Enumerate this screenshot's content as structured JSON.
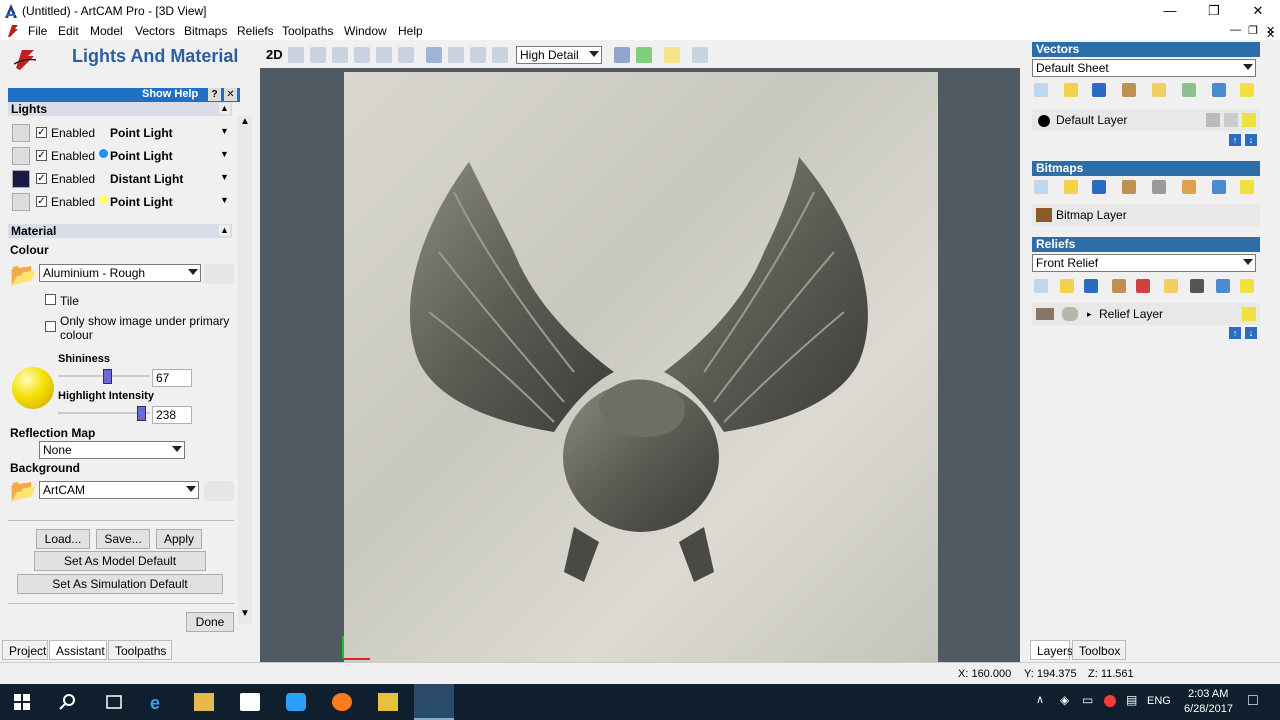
{
  "window": {
    "title": "(Untitled) - ArtCAM Pro - [3D View]"
  },
  "menu": [
    "File",
    "Edit",
    "Model",
    "Vectors",
    "Bitmaps",
    "Reliefs",
    "Toolpaths",
    "Window",
    "Help"
  ],
  "left": {
    "title": "Lights And Material",
    "show_help": "Show Help",
    "lights_header": "Lights",
    "lights": [
      {
        "enabled": "Enabled",
        "type": "Point Light",
        "dot": ""
      },
      {
        "enabled": "Enabled",
        "type": "Point Light",
        "dot": "#1e90ff"
      },
      {
        "enabled": "Enabled",
        "type": "Distant Light",
        "dot": ""
      },
      {
        "enabled": "Enabled",
        "type": "Point Light",
        "dot": "#ffff66"
      }
    ],
    "material_header": "Material",
    "colour_label": "Colour",
    "colour_value": "Aluminium - Rough",
    "tile": "Tile",
    "only_show": "Only show image under primary colour",
    "shininess_label": "Shininess",
    "shininess_value": "67",
    "highlight_label": "Highlight Intensity",
    "highlight_value": "238",
    "reflection_label": "Reflection Map",
    "reflection_value": "None",
    "background_label": "Background",
    "background_value": "ArtCAM",
    "load": "Load...",
    "save": "Save...",
    "apply": "Apply",
    "set_model": "Set As Model Default",
    "set_sim": "Set As Simulation Default",
    "done": "Done"
  },
  "view": {
    "mode": "2D",
    "detail": "High Detail"
  },
  "vectors": {
    "header": "Vectors",
    "sheet": "Default Sheet",
    "layer": "Default Layer"
  },
  "bitmaps": {
    "header": "Bitmaps",
    "layer": "Bitmap Layer"
  },
  "reliefs": {
    "header": "Reliefs",
    "sheet": "Front Relief",
    "layer": "Relief Layer"
  },
  "bottom_tabs": {
    "left": [
      "Project",
      "Assistant",
      "Toolpaths"
    ],
    "right": [
      "Layers",
      "Toolbox"
    ]
  },
  "status": {
    "x": "X: 160.000",
    "y": "Y: 194.375",
    "z": "Z: 11.561"
  },
  "taskbar": {
    "time": "2:03 AM",
    "date": "6/28/2017",
    "lang": "ENG"
  }
}
